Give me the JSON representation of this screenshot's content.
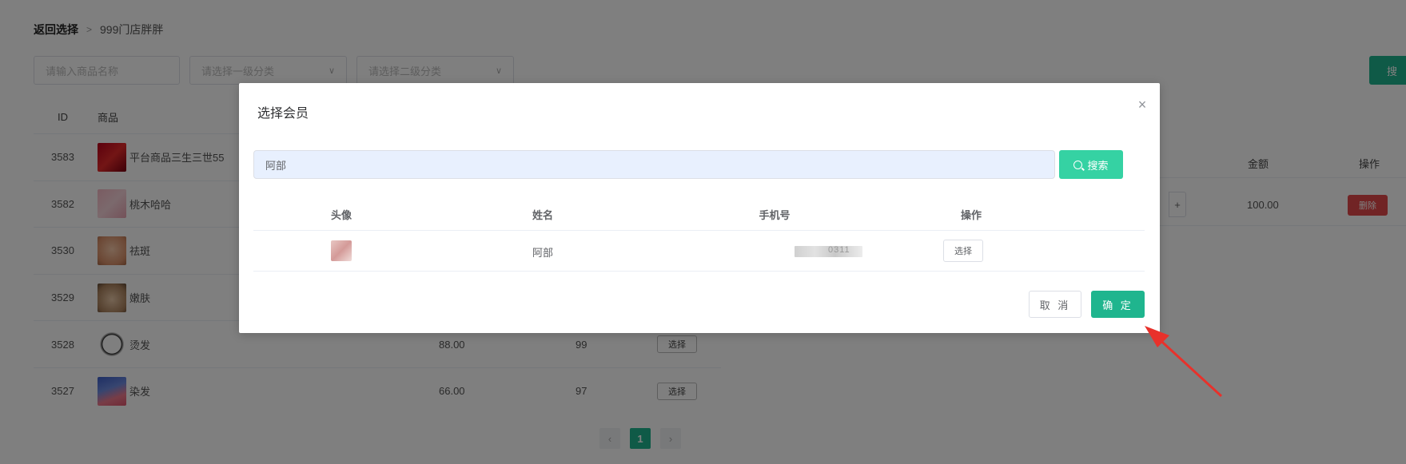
{
  "breadcrumb": {
    "back": "返回选择",
    "current": "999门店胖胖"
  },
  "filters": {
    "name_placeholder": "请输入商品名称",
    "cat1_placeholder": "请选择一级分类",
    "cat2_placeholder": "请选择二级分类"
  },
  "top_search_label": "搜",
  "goods_table": {
    "headers": {
      "id": "ID",
      "goods": "商品"
    },
    "rows": [
      {
        "id": "3583",
        "name": "平台商品三生三世55",
        "price": "",
        "stock": "",
        "btn": ""
      },
      {
        "id": "3582",
        "name": "桃木哈哈",
        "price": "",
        "stock": "",
        "btn": ""
      },
      {
        "id": "3530",
        "name": "祛斑",
        "price": "",
        "stock": "",
        "btn": ""
      },
      {
        "id": "3529",
        "name": "嫩肤",
        "price": "",
        "stock": "",
        "btn": ""
      },
      {
        "id": "3528",
        "name": "烫发",
        "price": "88.00",
        "stock": "99",
        "btn": "选择"
      },
      {
        "id": "3527",
        "name": "染发",
        "price": "66.00",
        "stock": "97",
        "btn": "选择"
      }
    ]
  },
  "pager": {
    "prev": "‹",
    "current": "1",
    "next": "›"
  },
  "cart": {
    "headers": {
      "amount": "金额",
      "operation": "操作"
    },
    "row": {
      "plus": "+",
      "amount": "100.00",
      "delete": "删除"
    }
  },
  "modal": {
    "title": "选择会员",
    "close": "×",
    "search_value": "阿部",
    "search_button": "搜索",
    "columns": {
      "avatar": "头像",
      "name": "姓名",
      "phone": "手机号",
      "operation": "操作"
    },
    "rows": [
      {
        "name": "阿部",
        "phone_visible": "0311",
        "select_label": "选择"
      }
    ],
    "cancel": "取 消",
    "confirm": "确 定"
  },
  "colors": {
    "accent": "#1fb58e",
    "search_btn": "#35d2a3",
    "danger": "#e2484a",
    "arrow": "#e8312b"
  }
}
